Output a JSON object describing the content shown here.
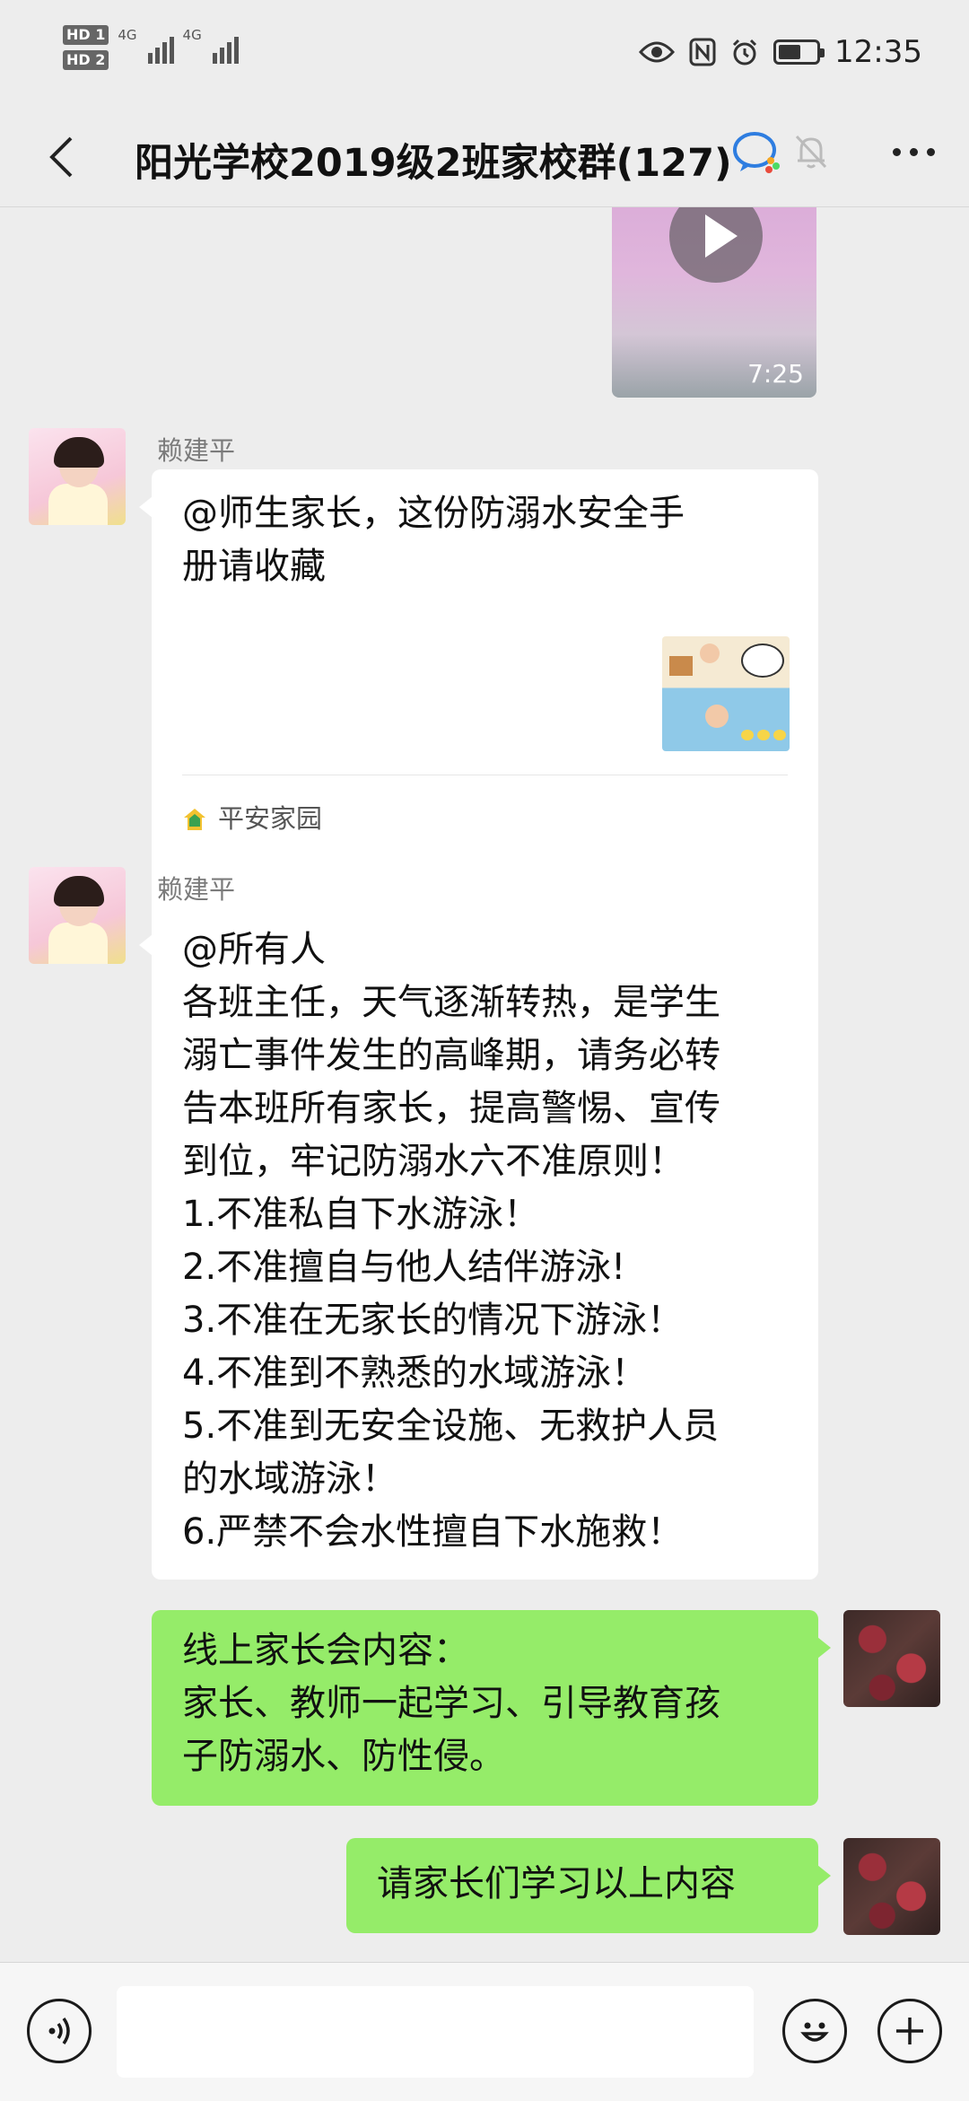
{
  "status_bar": {
    "sim1": "HD 1",
    "sim2": "HD 2",
    "net1": "4G",
    "net2": "4G",
    "battery_level": 0.6,
    "time": "12:35"
  },
  "header": {
    "title": "阳光学校2019级2班家校群(127)",
    "icons": [
      "back-chevron-icon",
      "enterprise-group-icon",
      "mute-bell-icon",
      "more-dots-icon"
    ]
  },
  "messages": {
    "video": {
      "duration": "7:25"
    },
    "msg1": {
      "sender": "赖建平",
      "text_line1": "@师生家长，这份防溺水安全手",
      "text_line2": "册请收藏",
      "source": "平安家园"
    },
    "msg2": {
      "sender": "赖建平",
      "lines": [
        "@所有人",
        "各班主任，天气逐渐转热，是学生",
        "溺亡事件发生的高峰期，请务必转",
        "告本班所有家长，提高警惕、宣传",
        "到位，牢记防溺水六不准原则！",
        "1.不准私自下水游泳！",
        "2.不准擅自与他人结伴游泳!",
        "3.不准在无家长的情况下游泳！",
        "4.不准到不熟悉的水域游泳！",
        "5.不准到无安全设施、无救护人员",
        "的水域游泳！",
        "6.严禁不会水性擅自下水施救！"
      ]
    },
    "msg3": {
      "lines": [
        "线上家长会内容：",
        "家长、教师一起学习、引导教育孩",
        "子防溺水、防性侵。"
      ]
    },
    "msg4": {
      "text": "请家长们学习以上内容"
    }
  },
  "input_bar": {
    "icons": [
      "voice-icon",
      "emoji-icon",
      "plus-icon"
    ],
    "value": ""
  },
  "colors": {
    "background": "#ededed",
    "green_bubble": "#95ec69",
    "white_bubble": "#ffffff"
  }
}
